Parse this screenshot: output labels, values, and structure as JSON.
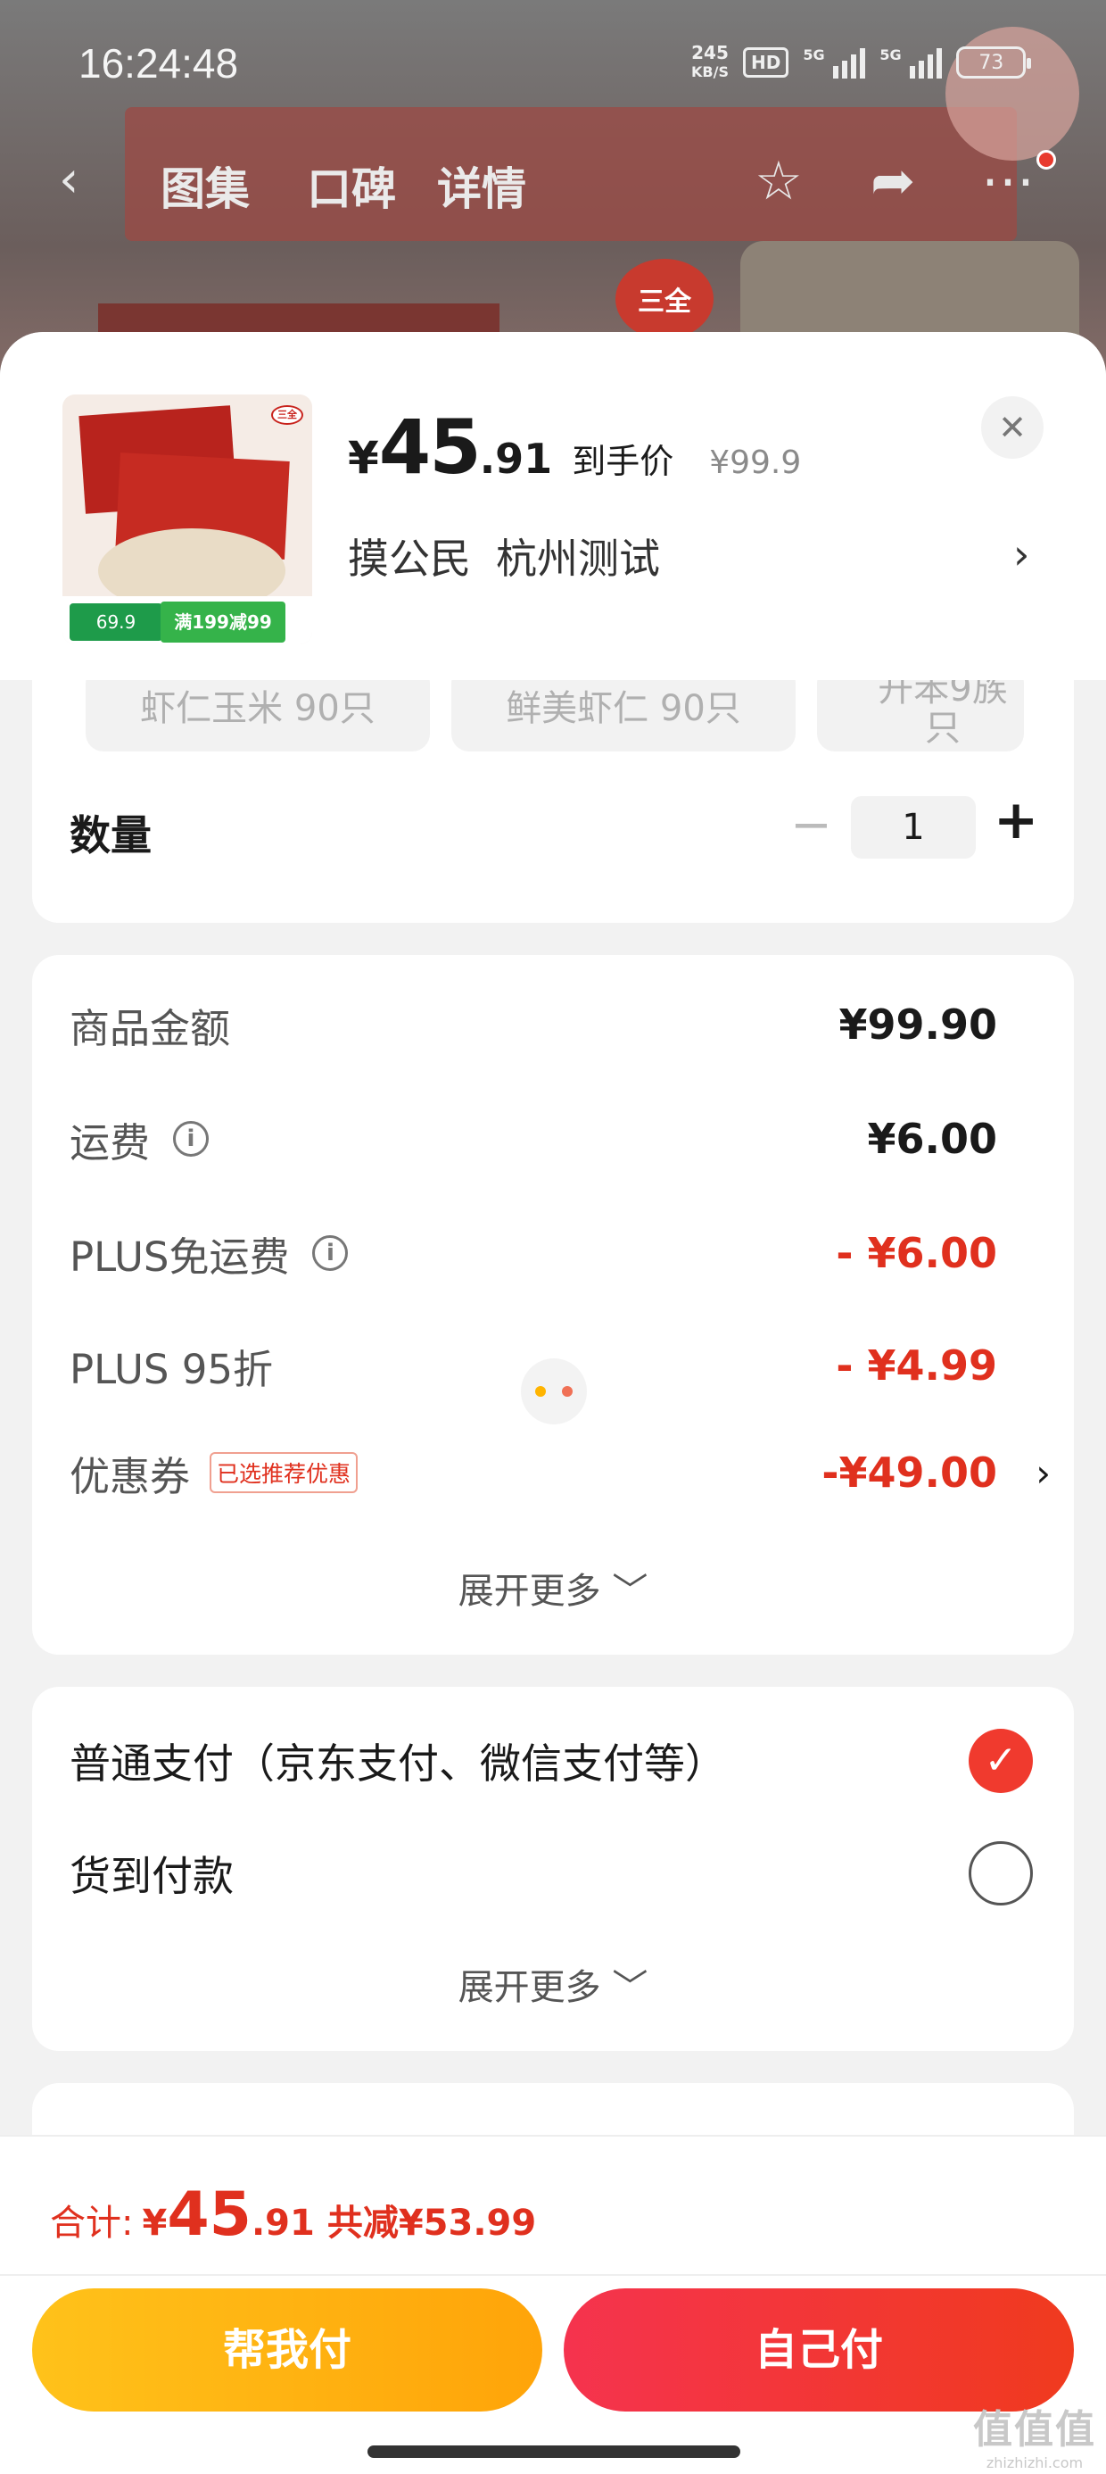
{
  "status_bar": {
    "time": "16:24:48",
    "net_speed_value": "245",
    "net_speed_unit": "KB/S",
    "hd_badge": "HD",
    "signal1_label": "5G",
    "signal2_label": "5G",
    "battery": "73"
  },
  "top_nav": {
    "tabs": [
      {
        "label": "图集"
      },
      {
        "label": "口碑"
      },
      {
        "label": "详情"
      }
    ],
    "icons": [
      "back-icon",
      "star-icon",
      "share-icon",
      "more-icon"
    ],
    "background_logo": "三全"
  },
  "product": {
    "price_yen": "¥",
    "price_int": "45",
    "price_dec": ".91",
    "price_tag": "到手价",
    "original_price": "¥99.9",
    "address_name": "摸公民",
    "address_city": "杭州测试",
    "image_logo": "三全",
    "image_badge": "69.9",
    "image_promo": "满199减99"
  },
  "specs": [
    {
      "label": "虾仁玉米 90只"
    },
    {
      "label": "鲜美虾仁 90只"
    },
    {
      "label": "开苯9族只"
    }
  ],
  "quantity": {
    "label": "数量",
    "minus": "−",
    "value": "1",
    "plus": "+"
  },
  "fees": {
    "goods_label": "商品金额",
    "goods_value": "¥99.90",
    "shipping_label": "运费",
    "shipping_value": "¥6.00",
    "plus_free_label": "PLUS免运费",
    "plus_free_value": "- ¥6.00",
    "plus_discount_label": "PLUS 95折",
    "plus_discount_value": "- ¥4.99",
    "coupon_label": "优惠券",
    "coupon_tag": "已选推荐优惠",
    "coupon_value": "-¥49.00",
    "expand": "展开更多 ﹀"
  },
  "payment": {
    "normal_label": "普通支付（京东支付、微信支付等）",
    "normal_selected": true,
    "cod_label": "货到付款",
    "cod_selected": false,
    "expand": "展开更多 ﹀"
  },
  "bottom": {
    "total_label": "合计:",
    "total_yen": "¥",
    "total_int": "45",
    "total_dec": ".91",
    "total_save": "共减¥53.99",
    "help_pay": "帮我付",
    "self_pay": "自己付"
  },
  "watermark": {
    "big": "值值值",
    "small": "zhizhizhi.com"
  },
  "colors": {
    "accent_red": "#e0301e",
    "btn_help": "#ffb412",
    "btn_self": "#f2333a"
  }
}
